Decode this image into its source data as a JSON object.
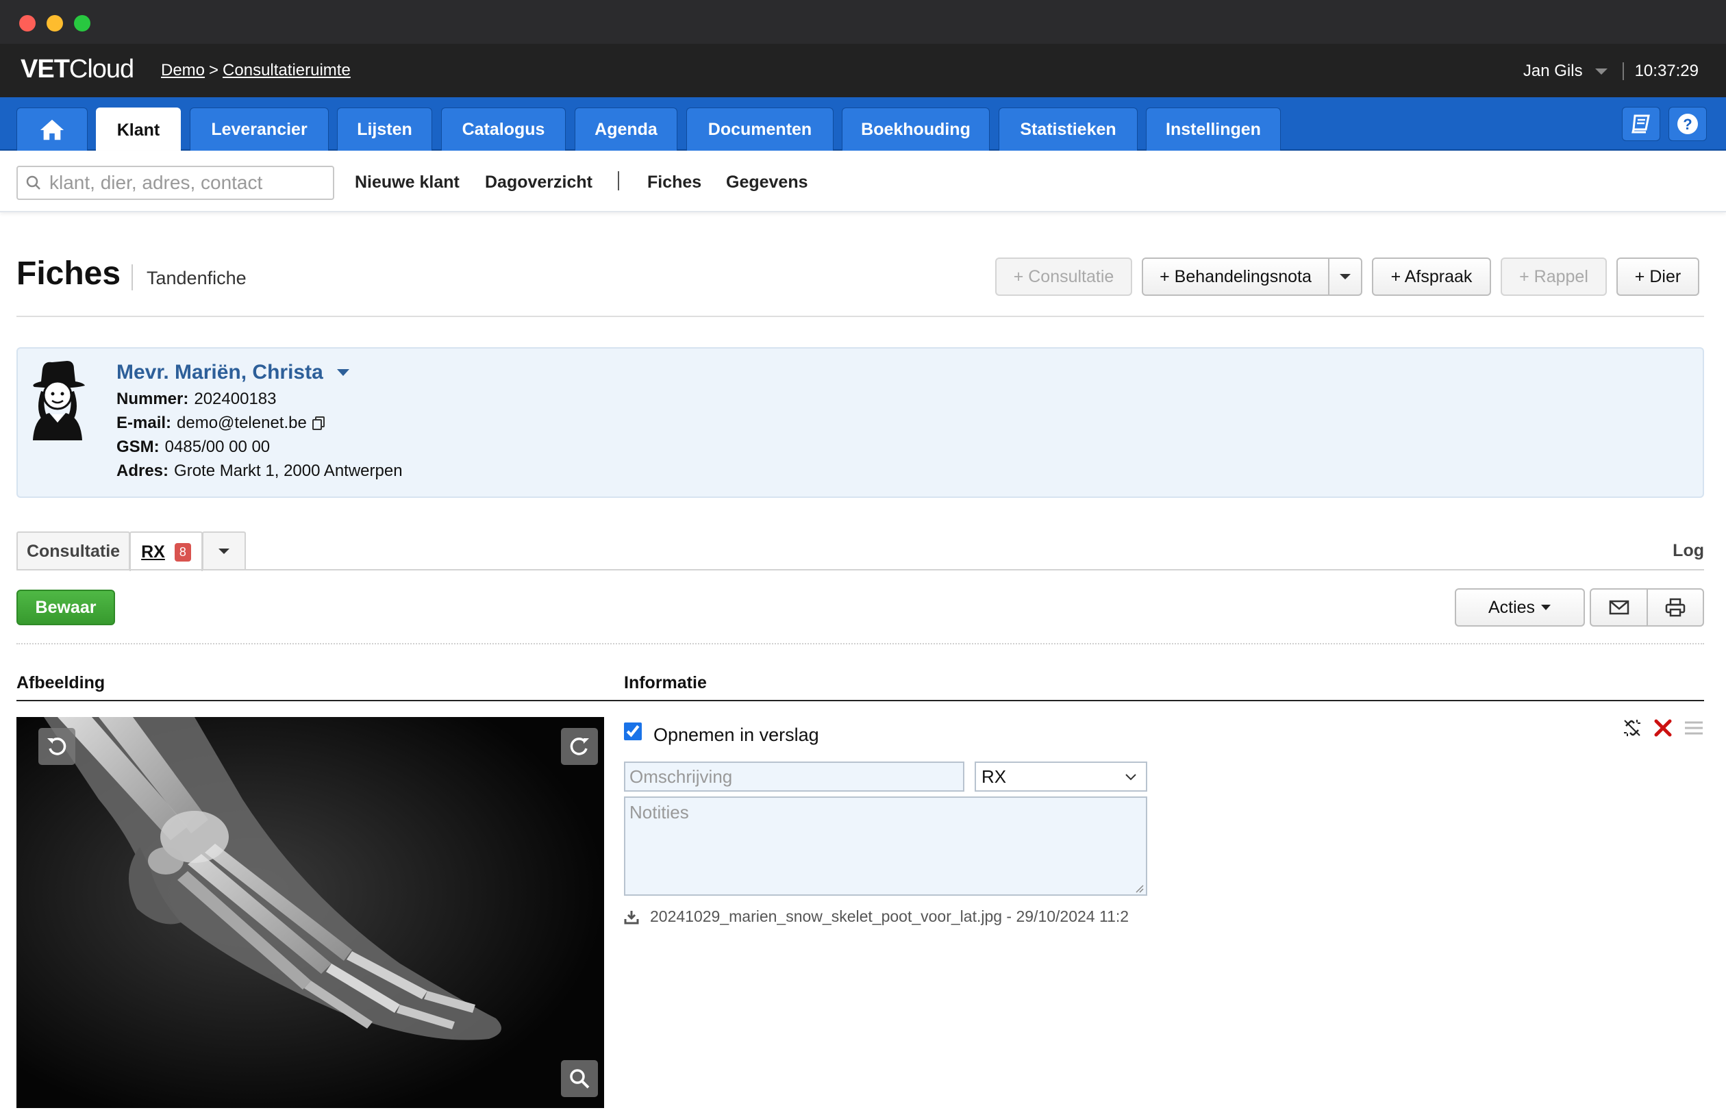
{
  "app": {
    "logo_bold": "VET",
    "logo_light": "Cloud",
    "breadcrumb": {
      "root": "Demo",
      "separator": ">",
      "current": "Consultatieruimte"
    },
    "user": "Jan Gils",
    "clock": "10:37:29"
  },
  "nav": {
    "tabs": [
      {
        "label": "Klant"
      },
      {
        "label": "Leverancier"
      },
      {
        "label": "Lijsten"
      },
      {
        "label": "Catalogus"
      },
      {
        "label": "Agenda"
      },
      {
        "label": "Documenten"
      },
      {
        "label": "Boekhouding"
      },
      {
        "label": "Statistieken"
      },
      {
        "label": "Instellingen"
      }
    ],
    "active_tab": "Klant",
    "icons": [
      "home-icon",
      "book-icon",
      "help-icon"
    ]
  },
  "subnav": {
    "search_placeholder": "klant, dier, adres, contact",
    "links": [
      "Nieuwe klant",
      "Dagoverzicht",
      "Fiches",
      "Gegevens"
    ]
  },
  "page": {
    "title": "Fiches",
    "subtitle": "Tandenfiche",
    "buttons": {
      "consultatie": "+ Consultatie",
      "behandelingsnota": "+ Behandelingsnota",
      "afspraak": "+ Afspraak",
      "rappel": "+ Rappel",
      "dier": "+ Dier"
    }
  },
  "client": {
    "name": "Mevr. Mariën, Christa",
    "nummer_label": "Nummer:",
    "nummer": "202400183",
    "email_label": "E-mail:",
    "email": "demo@telenet.be",
    "gsm_label": "GSM:",
    "gsm": "0485/00 00 00",
    "adres_label": "Adres:",
    "adres": "Grote Markt 1, 2000 Antwerpen"
  },
  "tabs": {
    "consultatie": "Consultatie",
    "rx": "RX",
    "rx_count": "8",
    "log": "Log"
  },
  "toolbar": {
    "save": "Bewaar",
    "acties": "Acties"
  },
  "sections": {
    "afbeelding": "Afbeelding",
    "informatie": "Informatie"
  },
  "form": {
    "include_label": "Opnemen in verslag",
    "include_checked": true,
    "description_placeholder": "Omschrijving",
    "type_selected": "RX",
    "notes_placeholder": "Notities",
    "file": "20241029_marien_snow_skelet_poot_voor_lat.jpg - 29/10/2024 11:2"
  },
  "colors": {
    "nav_blue": "#1a63c5",
    "save_green": "#3aa33a",
    "client_name_blue": "#2d5f99",
    "badge_red": "#d9534f",
    "delete_red": "#cc1111"
  }
}
